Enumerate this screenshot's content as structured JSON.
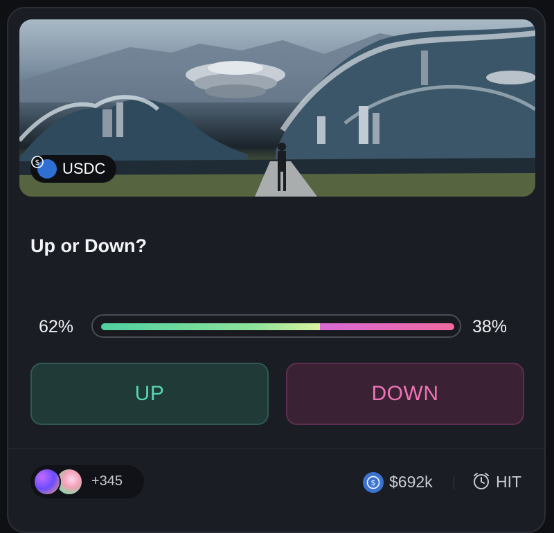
{
  "market": {
    "token": "USDC",
    "question": "Up or Down?",
    "up_percent_label": "62%",
    "down_percent_label": "38%",
    "up_fraction": 0.62,
    "down_fraction": 0.38
  },
  "buttons": {
    "up_label": "UP",
    "down_label": "DOWN"
  },
  "footer": {
    "participants_extra": "+345",
    "volume": "$692k",
    "status": "HIT"
  },
  "colors": {
    "up": "#56d6b4",
    "down": "#ef73b6",
    "usdc": "#2f6fd1"
  },
  "icons": {
    "token": "usdc-icon",
    "volume": "usdc-icon",
    "status": "alarm-clock-icon"
  }
}
